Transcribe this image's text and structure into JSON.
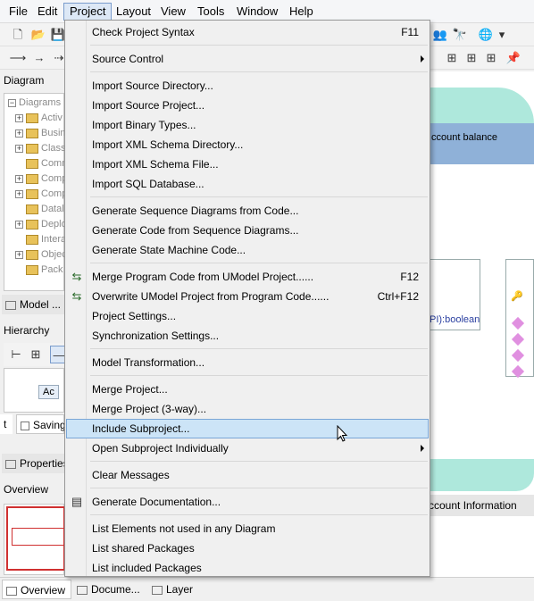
{
  "menubar": {
    "items": [
      "File",
      "Edit",
      "Project",
      "Layout",
      "View",
      "Tools",
      "Window",
      "Help"
    ]
  },
  "toolbar": {
    "row1_icons": [
      "new-icon",
      "open-icon",
      "save-icon"
    ],
    "row1_right_icons": [
      "people-icon",
      "binoculars-icon",
      "globe-icon"
    ],
    "row2_icons": [
      "arrow-icon",
      "arrow-icon",
      "connector-icon"
    ],
    "row2_right_icons": [
      "fetch-icon",
      "fetch-icon",
      "fetch-icon",
      "pin-icon"
    ]
  },
  "left": {
    "diagram_tree_title": "Diagram Tree",
    "tree_items": [
      "Diagrams",
      "Activ",
      "Busin",
      "Class",
      "Comm",
      "Comp",
      "Comp",
      "Datal",
      "Deplo",
      "Intera",
      "Objec",
      "Pack"
    ],
    "model_tab": "Model ...",
    "hierarchy_title": "Hierarchy",
    "hierarchy_node": "Ac",
    "hierarchy_tab_it": "t",
    "hierarchy_tab_saving": "Saving",
    "properties_tab": "Properties",
    "overview_title": "Overview"
  },
  "bottom_tabs": [
    "Overview",
    "Docume...",
    "Layer"
  ],
  "diagram": {
    "text_account_balance": "ccount balance",
    "text_boolean": "PI):boolean",
    "text_account_information": "ccount Information"
  },
  "menu": {
    "items": [
      {
        "label": "Check Project Syntax",
        "shortcut": "F11"
      },
      {
        "label": "Source Control",
        "submenu": true
      },
      {
        "label": "Import Source Directory..."
      },
      {
        "label": "Import Source Project..."
      },
      {
        "label": "Import Binary Types..."
      },
      {
        "label": "Import XML Schema Directory..."
      },
      {
        "label": "Import XML Schema File..."
      },
      {
        "label": "Import SQL Database..."
      },
      {
        "label": "Generate Sequence Diagrams from Code..."
      },
      {
        "label": "Generate Code from Sequence Diagrams..."
      },
      {
        "label": "Generate State Machine Code..."
      },
      {
        "label": "Merge Program Code from UModel Project......",
        "shortcut": "F12",
        "icon": "merge-code-icon"
      },
      {
        "label": "Overwrite UModel Project from Program Code......",
        "shortcut": "Ctrl+F12",
        "icon": "overwrite-project-icon"
      },
      {
        "label": "Project Settings..."
      },
      {
        "label": "Synchronization Settings..."
      },
      {
        "label": "Model Transformation..."
      },
      {
        "label": "Merge Project..."
      },
      {
        "label": "Merge Project (3-way)..."
      },
      {
        "label": "Include Subproject...",
        "highlighted": true
      },
      {
        "label": "Open Subproject Individually",
        "submenu": true
      },
      {
        "label": "Clear Messages"
      },
      {
        "label": "Generate Documentation...",
        "icon": "documentation-icon"
      },
      {
        "label": "List Elements not used in any Diagram"
      },
      {
        "label": "List shared Packages"
      },
      {
        "label": "List included Packages"
      }
    ]
  }
}
